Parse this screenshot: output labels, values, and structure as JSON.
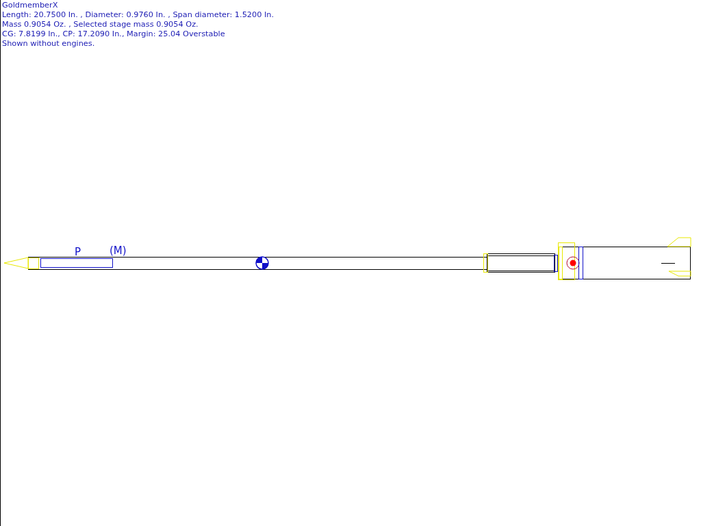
{
  "info": {
    "title": "GoldmemberX",
    "lines": [
      "Length: 20.7500 In. , Diameter: 0.9760 In. , Span diameter: 1.5200 In.",
      "Mass 0.9054 Oz. , Selected stage mass 0.9054 Oz.",
      "CG: 7.8199 In., CP: 17.2090 In., Margin: 25.04 Overstable",
      "Shown without engines."
    ]
  },
  "drawing": {
    "labels": [
      "P",
      "(M)"
    ]
  }
}
